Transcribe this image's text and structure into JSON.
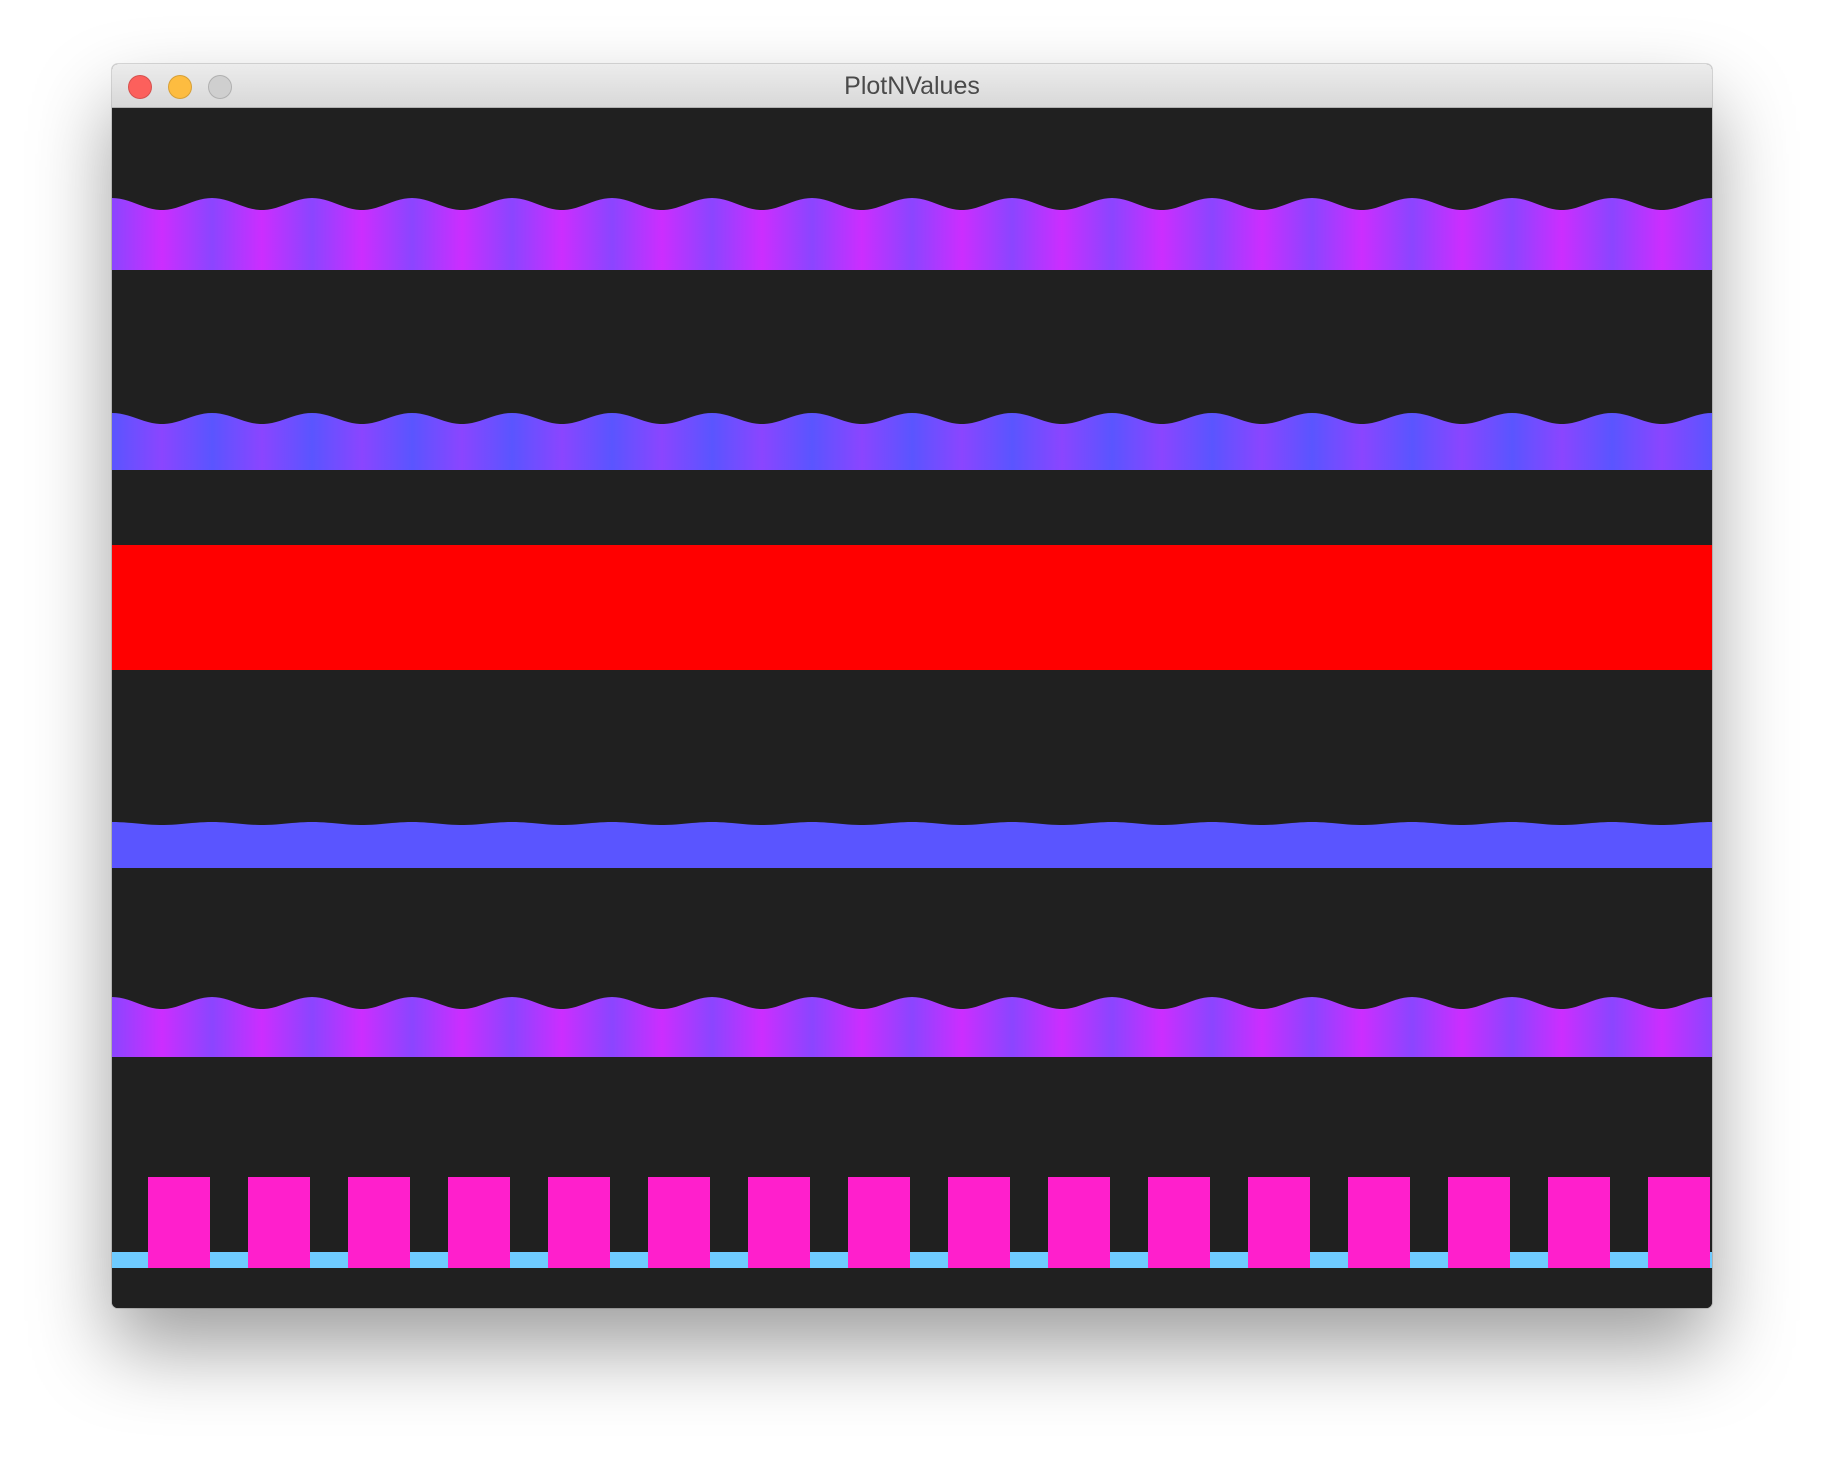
{
  "window": {
    "title": "PlotNValues",
    "traffic_lights": [
      {
        "name": "close",
        "color": "#fc605c"
      },
      {
        "name": "minimize",
        "color": "#fdbc40"
      },
      {
        "name": "zoom",
        "color": "#cfcfcf"
      }
    ]
  },
  "plot": {
    "background_color": "#202020",
    "cycles_across": 16,
    "bands": [
      {
        "name": "wave-band-1",
        "kind": "wave",
        "colors": [
          "#8b45ff",
          "#cc2dff"
        ]
      },
      {
        "name": "wave-band-2",
        "kind": "wave",
        "colors": [
          "#5a55ff",
          "#8a45ff"
        ]
      },
      {
        "name": "solid-band",
        "kind": "solid",
        "colors": [
          "#ff0000"
        ]
      },
      {
        "name": "flat-wave-band",
        "kind": "wave",
        "colors": [
          "#5a55ff",
          "#5a55ff"
        ]
      },
      {
        "name": "wave-band-3",
        "kind": "wave",
        "colors": [
          "#8b45ff",
          "#cc2dff"
        ]
      },
      {
        "name": "square-wave-band",
        "kind": "square",
        "colors": [
          "#ff1fcc",
          "#6ecbff"
        ]
      }
    ]
  }
}
